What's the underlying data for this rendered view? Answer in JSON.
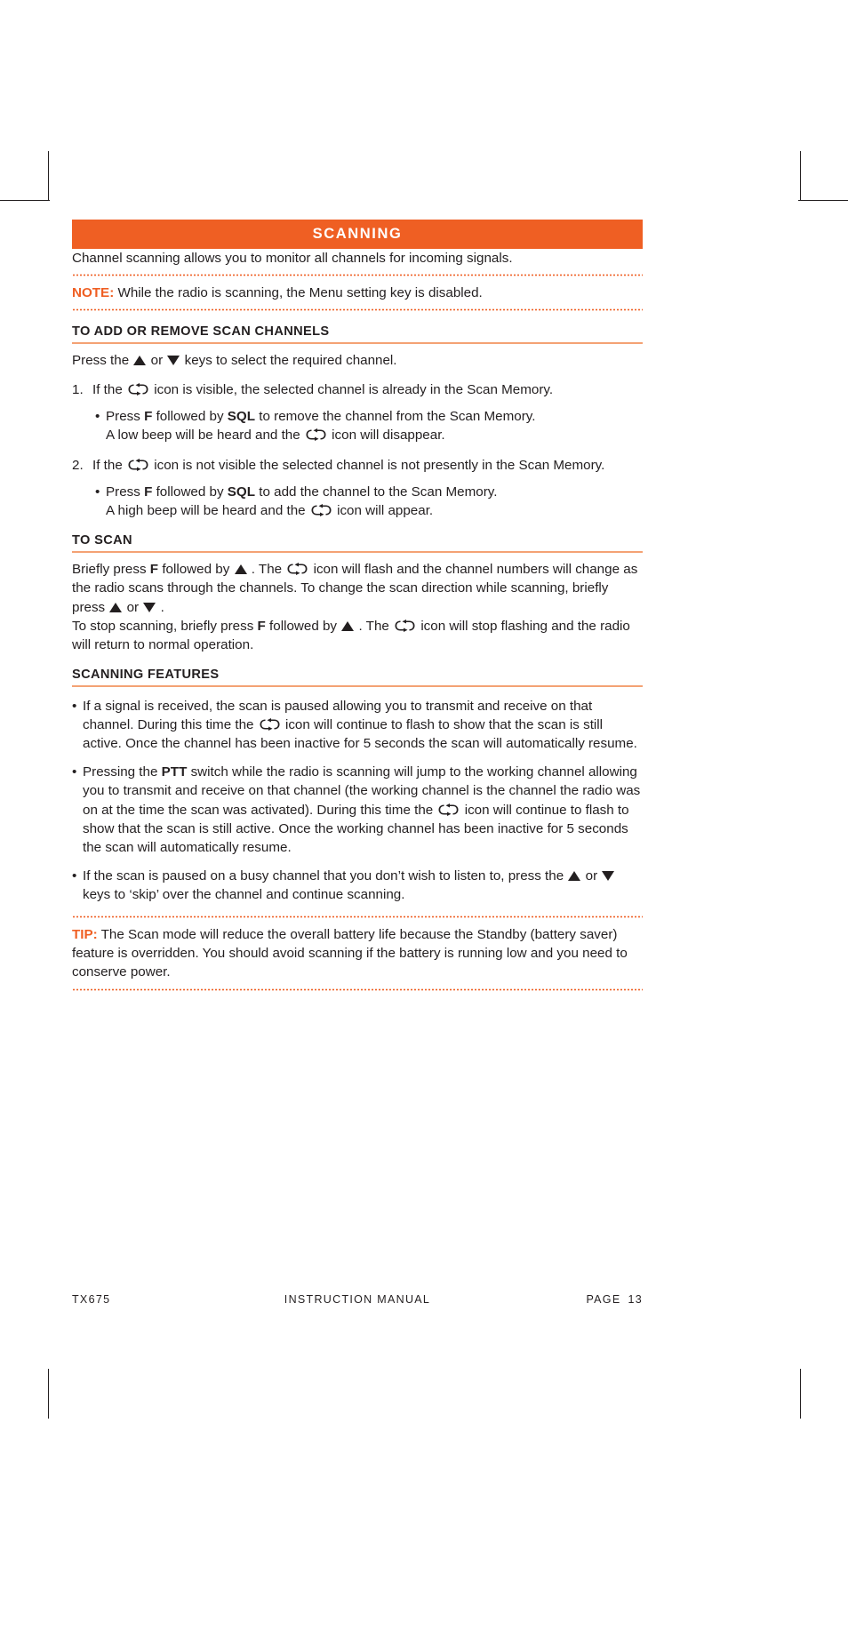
{
  "banner": {
    "title": "SCANNING"
  },
  "intro": "Channel scanning allows you to monitor all channels for incoming signals.",
  "note": {
    "label": "NOTE:",
    "text": "While the radio is scanning, the Menu setting key is disabled."
  },
  "section_add_remove": {
    "heading": "TO ADD OR REMOVE SCAN CHANNELS",
    "intro_a": "Press the",
    "intro_b": "or",
    "intro_c": "keys to select the required channel.",
    "items": [
      {
        "num": "1.",
        "before": "If the",
        "after": "icon is visible, the selected channel is already in the Scan Memory.",
        "bullet": {
          "dot": "•",
          "p1": "Press",
          "key1": "F",
          "p2": "followed by",
          "key2": "SQL",
          "p3": "to remove the channel from the Scan Memory.",
          "p4": "A low beep will be heard and the",
          "p5": "icon will disappear."
        }
      },
      {
        "num": "2.",
        "before": "If the",
        "after": "icon is not visible the selected channel is not presently in the Scan Memory.",
        "bullet": {
          "dot": "•",
          "p1": "Press",
          "key1": "F",
          "p2": "followed by",
          "key2": "SQL",
          "p3": "to add the channel to the Scan Memory.",
          "p4": "A high beep will be heard and the",
          "p5": "icon will appear."
        }
      }
    ]
  },
  "section_to_scan": {
    "heading": "TO SCAN",
    "para1": {
      "p1": "Briefly press",
      "key1": "F",
      "p2": "followed by",
      "p3": ". The",
      "p4": "icon will flash and the channel numbers will change as the radio scans through the channels. To change the scan direction while scanning, briefly press",
      "p5": "or",
      "p6": "."
    },
    "para2": {
      "p1": "To stop scanning, briefly press",
      "key1": "F",
      "p2": "followed by",
      "p3": ". The",
      "p4": "icon will stop flashing and the radio will return to normal operation."
    }
  },
  "section_features": {
    "heading": "SCANNING FEATURES",
    "bullets": [
      {
        "dot": "•",
        "p1": "If a signal is received, the scan is paused allowing you to transmit and receive on that channel. During this time the",
        "p2": "icon will continue to flash to show that the scan is still active. Once the channel has been inactive for 5 seconds the scan will automatically resume."
      },
      {
        "dot": "•",
        "p1": "Pressing the",
        "key1": "PTT",
        "p2": "switch while the radio is scanning will jump to the working channel allowing you to transmit and receive on that channel (the working channel is the channel the radio was on at the time the scan was activated). During this time the",
        "p3": "icon will continue to flash to show that the scan is still active. Once the working channel has been inactive for 5 seconds the scan will automatically resume."
      },
      {
        "dot": "•",
        "p1": "If the scan is paused on a busy channel that you don’t wish to listen to, press the",
        "p2": "or",
        "p3": "keys to ‘skip’ over the channel and continue scanning."
      }
    ]
  },
  "tip": {
    "label": "TIP:",
    "text": "The Scan mode will reduce the overall battery life because the Standby (battery saver) feature is overridden. You should avoid scanning if the battery is running low and you need to conserve power."
  },
  "footer": {
    "model": "TX675",
    "center": "INSTRUCTION MANUAL",
    "page_label": "PAGE",
    "page_number": "13"
  },
  "icons": {
    "scan": "scan-loop-icon",
    "up": "triangle-up-icon",
    "down": "triangle-down-icon"
  },
  "colors": {
    "accent": "#ef5f23",
    "accent_light": "#f4a274",
    "text": "#231f20"
  }
}
